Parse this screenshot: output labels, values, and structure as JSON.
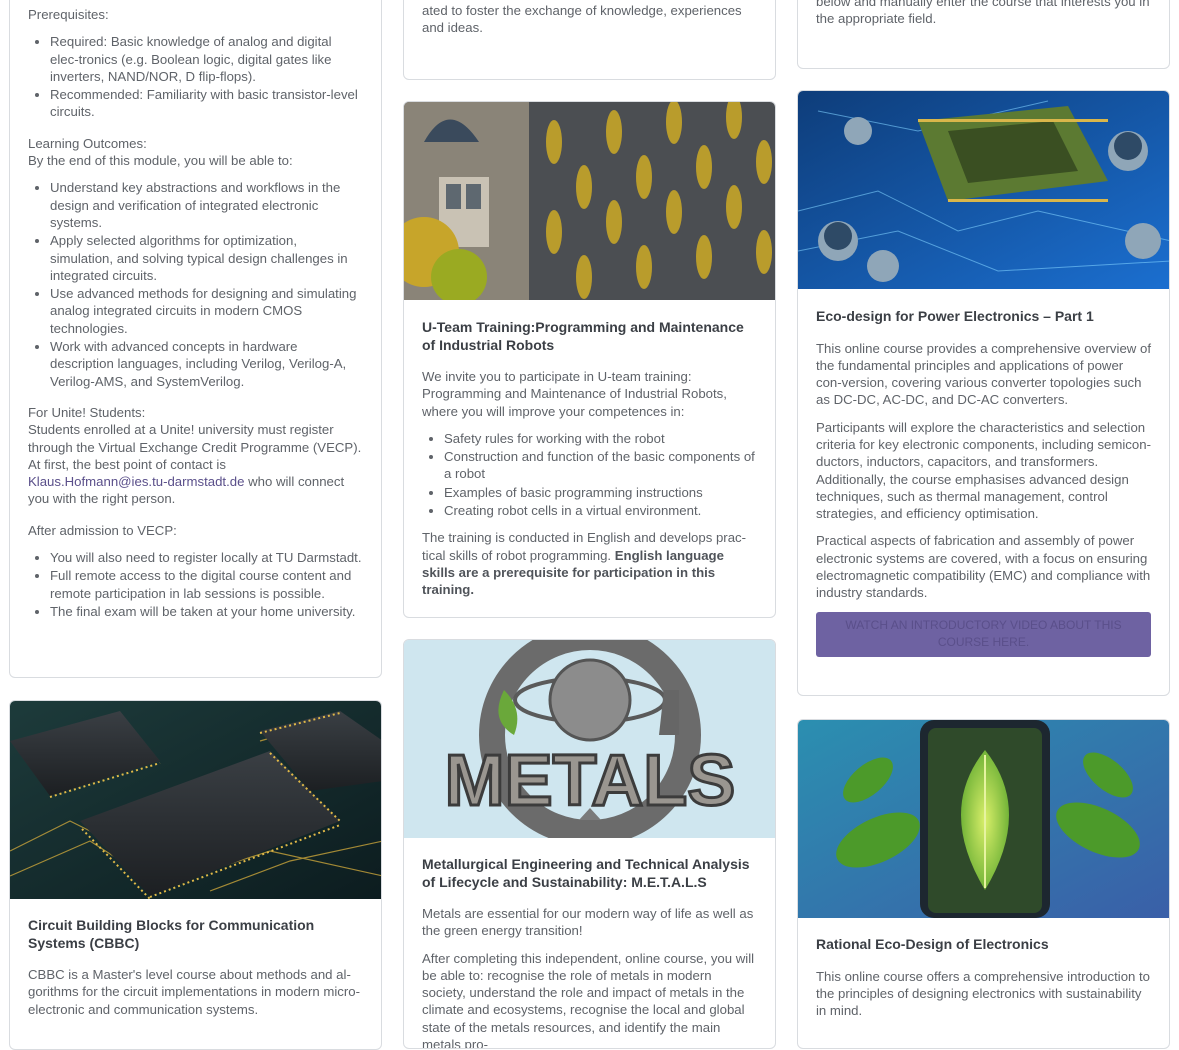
{
  "col1_card1": {
    "prereq_heading": "Prerequisites:",
    "prereq_items": [
      "Required: Basic knowledge of analog and digital elec-tronics (e.g. Boolean logic, digital gates like inverters, NAND/NOR, D flip-flops).",
      "Recommended: Familiarity with basic transistor-level circuits."
    ],
    "outcomes_heading": "Learning Outcomes:",
    "outcomes_intro": "By the end of this module, you will be able to:",
    "outcomes_items": [
      "Understand key abstractions and workflows in the design and verification of integrated electronic systems.",
      "Apply selected algorithms for optimization, simulation, and solving typical design challenges in integrated circuits.",
      "Use advanced methods for designing and simulating analog integrated circuits in modern CMOS technologies.",
      "Work with advanced concepts in hardware description languages, including Verilog, Verilog-A, Verilog-AMS, and SystemVerilog."
    ],
    "unite_heading": "For Unite! Students:",
    "unite_text_1": "Students enrolled at a Unite! university must register through the Virtual Exchange Credit Programme (VECP). At first, the best point of contact is",
    "unite_email": "Klaus.Hofmann@ies.tu-darmstadt.de",
    "unite_text_2": "who will connect you with the right person.",
    "vecp_heading": "After admission to VECP:",
    "vecp_items": [
      "You will also need to register locally at TU Darmstadt.",
      "Full remote access to the digital course content and remote participation in lab sessions is possible.",
      "The final exam will be taken at your home university."
    ]
  },
  "col1_card2": {
    "title": "Circuit Building Blocks for Communication Systems (CBBC)",
    "text": "CBBC is a Master's level course about methods and al-gorithms for the circuit implementations in modern micro-electronic and communication systems."
  },
  "col2_card1": {
    "text_tail": "ated to foster the exchange of knowledge, experiences and ideas."
  },
  "col2_card2": {
    "title": "U-Team Training:Programming and Maintenance of Industrial Robots",
    "intro": "We invite you to participate in U-team training: Programming and Maintenance of Industrial Robots, where you will improve your competences in:",
    "items": [
      "Safety rules for working with the robot",
      "Construction and function of the basic components of a robot",
      "Examples of basic programming instructions",
      "Creating robot cells in a virtual environment."
    ],
    "closing": "The training is conducted in English and develops prac-tical skills of robot programming.",
    "closing_bold": "English language skills are a prerequisite for participation in this training."
  },
  "col2_card3": {
    "logo_text": "METALS",
    "title": "Metallurgical Engineering and Technical Analysis of Lifecycle and Sustainability: M.E.T.A.L.S",
    "text_1": "Metals are essential for our modern way of life as well as the green energy transition!",
    "text_2": "After completing this independent, online course, you will be able to: recognise the role of metals in modern society, understand the role and impact of metals in the climate and ecosystems, recognise the local and global state of the metals resources, and identify the main metals pro-"
  },
  "col3_card1": {
    "text_tail": "below and manually enter the course that interests you in the appropriate field."
  },
  "col3_card2": {
    "title": "Eco-design for Power Electronics – Part 1",
    "text_1": "This online course provides a comprehensive overview of the fundamental principles and applications of power con-version, covering various converter topologies such as DC-DC, AC-DC, and DC-AC converters.",
    "text_2": "Participants will explore the characteristics and selection criteria for key electronic components, including semicon-ductors, inductors, capacitors, and transformers. Additionally, the course emphasises advanced design techniques, such as thermal management, control strategies, and efficiency optimisation.",
    "text_3": "Practical aspects of fabrication and assembly of power electronic systems are covered, with a focus on ensuring electromagnetic compatibility (EMC) and compliance with industry standards.",
    "button": "WATCH AN INTRODUCTORY VIDEO ABOUT THIS COURSE HERE."
  },
  "col3_card3": {
    "title": "Rational Eco-Design of Electronics",
    "text": "This online course offers a comprehensive introduction to the principles of designing electronics with sustainability in mind."
  },
  "colors": {
    "accent": "#6e62a2",
    "link": "#5a4f8a",
    "border": "#d9dce0"
  }
}
